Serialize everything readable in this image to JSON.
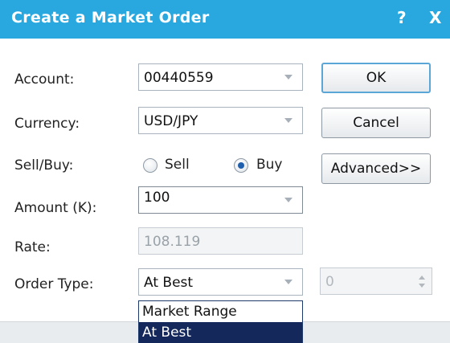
{
  "window": {
    "title": "Create a Market Order",
    "help_glyph": "?",
    "close_glyph": "X",
    "accent_color": "#29a8e0"
  },
  "form": {
    "account": {
      "label": "Account:",
      "value": "00440559"
    },
    "currency": {
      "label": "Currency:",
      "value": "USD/JPY"
    },
    "side": {
      "label": "Sell/Buy:",
      "options": [
        "Sell",
        "Buy"
      ],
      "selected": "Buy"
    },
    "amount": {
      "label": "Amount (K):",
      "value": "100"
    },
    "rate": {
      "label": "Rate:",
      "value": "108.119"
    },
    "order_type": {
      "label": "Order Type:",
      "value": "At Best",
      "options": [
        "Market Range",
        "At Best"
      ],
      "highlighted": "At Best"
    },
    "range_value": "0"
  },
  "buttons": {
    "ok": "OK",
    "cancel": "Cancel",
    "advanced": "Advanced>>"
  }
}
